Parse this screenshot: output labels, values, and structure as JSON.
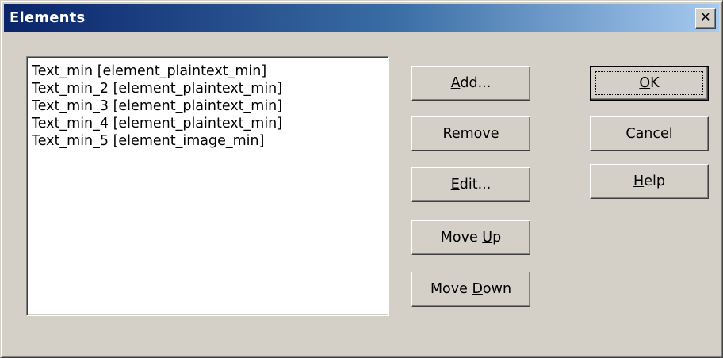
{
  "window": {
    "title": "Elements",
    "close_label": "✕"
  },
  "list": {
    "items": [
      "Text_min [element_plaintext_min]",
      "Text_min_2 [element_plaintext_min]",
      "Text_min_3 [element_plaintext_min]",
      "Text_min_4 [element_plaintext_min]",
      "Text_min_5 [element_image_min]"
    ]
  },
  "buttons": {
    "add": {
      "mnemonic": "A",
      "rest": "dd..."
    },
    "remove": {
      "mnemonic": "R",
      "rest": "emove"
    },
    "edit": {
      "mnemonic": "E",
      "rest": "dit..."
    },
    "move_up": {
      "pre": "Move ",
      "mnemonic": "U",
      "rest": "p"
    },
    "move_down": {
      "pre": "Move ",
      "mnemonic": "D",
      "rest": "own"
    },
    "ok": {
      "mnemonic": "O",
      "rest": "K"
    },
    "cancel": {
      "mnemonic": "C",
      "rest": "ancel"
    },
    "help": {
      "mnemonic": "H",
      "rest": "elp"
    }
  }
}
